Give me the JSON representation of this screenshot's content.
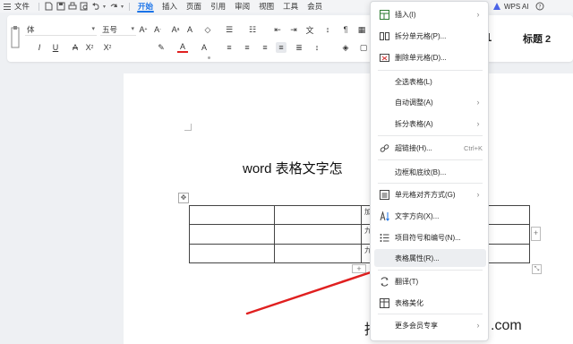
{
  "menubar": {
    "file_label": "文件",
    "tabs": [
      {
        "label": "开始",
        "active": true
      },
      {
        "label": "插入"
      },
      {
        "label": "页面"
      },
      {
        "label": "引用"
      },
      {
        "label": "审阅"
      },
      {
        "label": "视图"
      },
      {
        "label": "工具"
      },
      {
        "label": "会员"
      }
    ],
    "wps_ai_label": "WPS AI"
  },
  "ribbon": {
    "font_name": "体",
    "font_size": "五号",
    "style_heading1": "1",
    "style_heading2": "标题 2"
  },
  "document": {
    "title": "word 表格文字怎",
    "table_cells": [
      [
        "",
        "",
        "加",
        ""
      ],
      [
        "",
        "",
        "九",
        ""
      ],
      [
        "",
        "",
        "九",
        ""
      ]
    ],
    "watermark_left": "招",
    "watermark_right": ".com"
  },
  "context_menu": {
    "items": [
      {
        "label": "插入(I)",
        "icon": "table-insert-icon",
        "submenu": true
      },
      {
        "label": "拆分单元格(P)...",
        "icon": "split-cells-icon"
      },
      {
        "label": "删除单元格(D)...",
        "icon": "delete-cells-icon"
      },
      {
        "label": "全选表格(L)"
      },
      {
        "label": "自动调整(A)",
        "submenu": true
      },
      {
        "label": "拆分表格(A)",
        "submenu": true
      },
      {
        "label": "超链接(H)...",
        "icon": "link-icon",
        "shortcut": "Ctrl+K"
      },
      {
        "label": "边框和底纹(B)..."
      },
      {
        "label": "单元格对齐方式(G)",
        "icon": "cell-align-icon",
        "submenu": true
      },
      {
        "label": "文字方向(X)...",
        "icon": "text-direction-icon"
      },
      {
        "label": "项目符号和编号(N)...",
        "icon": "bullets-icon"
      },
      {
        "label": "表格属性(R)...",
        "highlighted": true
      },
      {
        "label": "翻译(T)",
        "icon": "translate-icon"
      },
      {
        "label": "表格美化",
        "icon": "table-beautify-icon"
      },
      {
        "label": "更多会员专享",
        "submenu": true
      }
    ]
  },
  "colors": {
    "accent": "#1a73e8",
    "arrow": "#e02020",
    "menu_highlight": "#eceef1"
  }
}
